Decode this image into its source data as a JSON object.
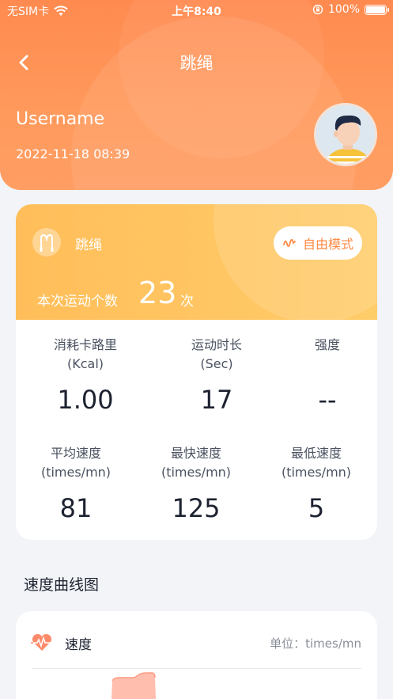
{
  "status_bar": {
    "carrier": "无SIM卡",
    "time": "上午8:40",
    "battery": "100%"
  },
  "nav": {
    "title": "跳绳"
  },
  "profile": {
    "username": "Username",
    "datetime": "2022-11-18 08:39"
  },
  "summary": {
    "sport_name": "跳绳",
    "mode_label": "自由模式",
    "count_label": "本次运动个数",
    "count_value": "23",
    "count_unit": "次"
  },
  "stats": [
    {
      "label1": "消耗卡路里",
      "label2": "(Kcal)",
      "value": "1.00"
    },
    {
      "label1": "运动时长",
      "label2": "(Sec)",
      "value": "17"
    },
    {
      "label1": "强度",
      "label2": "",
      "value": "--"
    },
    {
      "label1": "平均速度",
      "label2": "(times/mn)",
      "value": "81"
    },
    {
      "label1": "最快速度",
      "label2": "(times/mn)",
      "value": "125"
    },
    {
      "label1": "最低速度",
      "label2": "(times/mn)",
      "value": "5"
    }
  ],
  "speed_section": {
    "title": "速度曲线图",
    "card_title": "速度",
    "unit_label": "单位：times/mn"
  },
  "colors": {
    "header": "#ff8a4f",
    "card_top": "#ffc460",
    "accent": "#ff8a45",
    "chart_fill": "#ffb3a0"
  }
}
